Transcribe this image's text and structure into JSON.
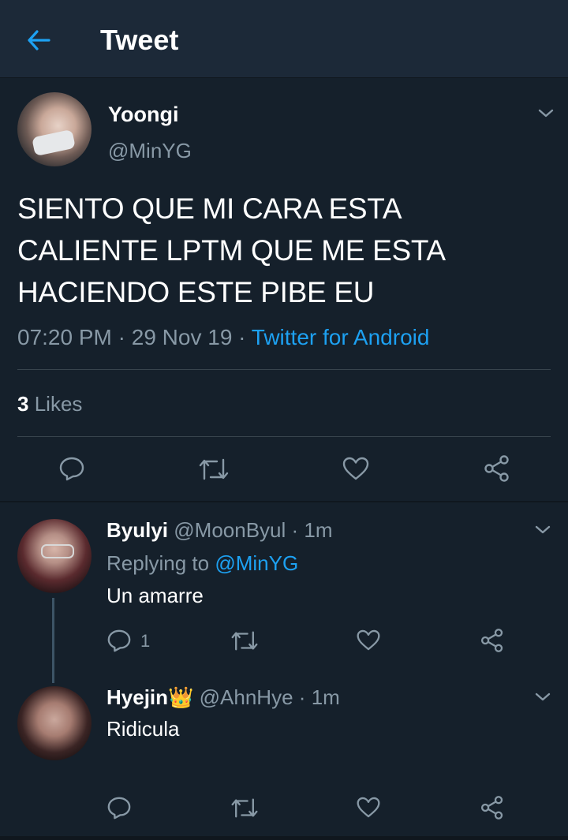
{
  "header": {
    "title": "Tweet",
    "back_icon": "arrow-left-icon",
    "accent": "#1da1f2"
  },
  "main_tweet": {
    "name": "Yoongi",
    "handle": "@MinYG",
    "text": "SIENTO QUE MI CARA ESTA CALIENTE LPTM QUE ME ESTA HACIENDO ESTE PIBE EU",
    "time": "07:20 PM",
    "date": "29 Nov 19",
    "source": "Twitter for Android",
    "likes_count": "3",
    "likes_label": "Likes"
  },
  "replies": [
    {
      "name": "Byulyi",
      "handle": "@MoonByul",
      "time": "1m",
      "replying_to_label": "Replying to",
      "replying_to": "@MinYG",
      "text": "Un amarre",
      "reply_count": "1"
    },
    {
      "name": "Hyejin👑",
      "handle": "@AhnHye",
      "time": "1m",
      "text": "Ridicula"
    }
  ],
  "colors": {
    "background": "#15202b",
    "header_bg": "#1c2938",
    "secondary_text": "#8899a6",
    "link": "#1da1f2"
  }
}
